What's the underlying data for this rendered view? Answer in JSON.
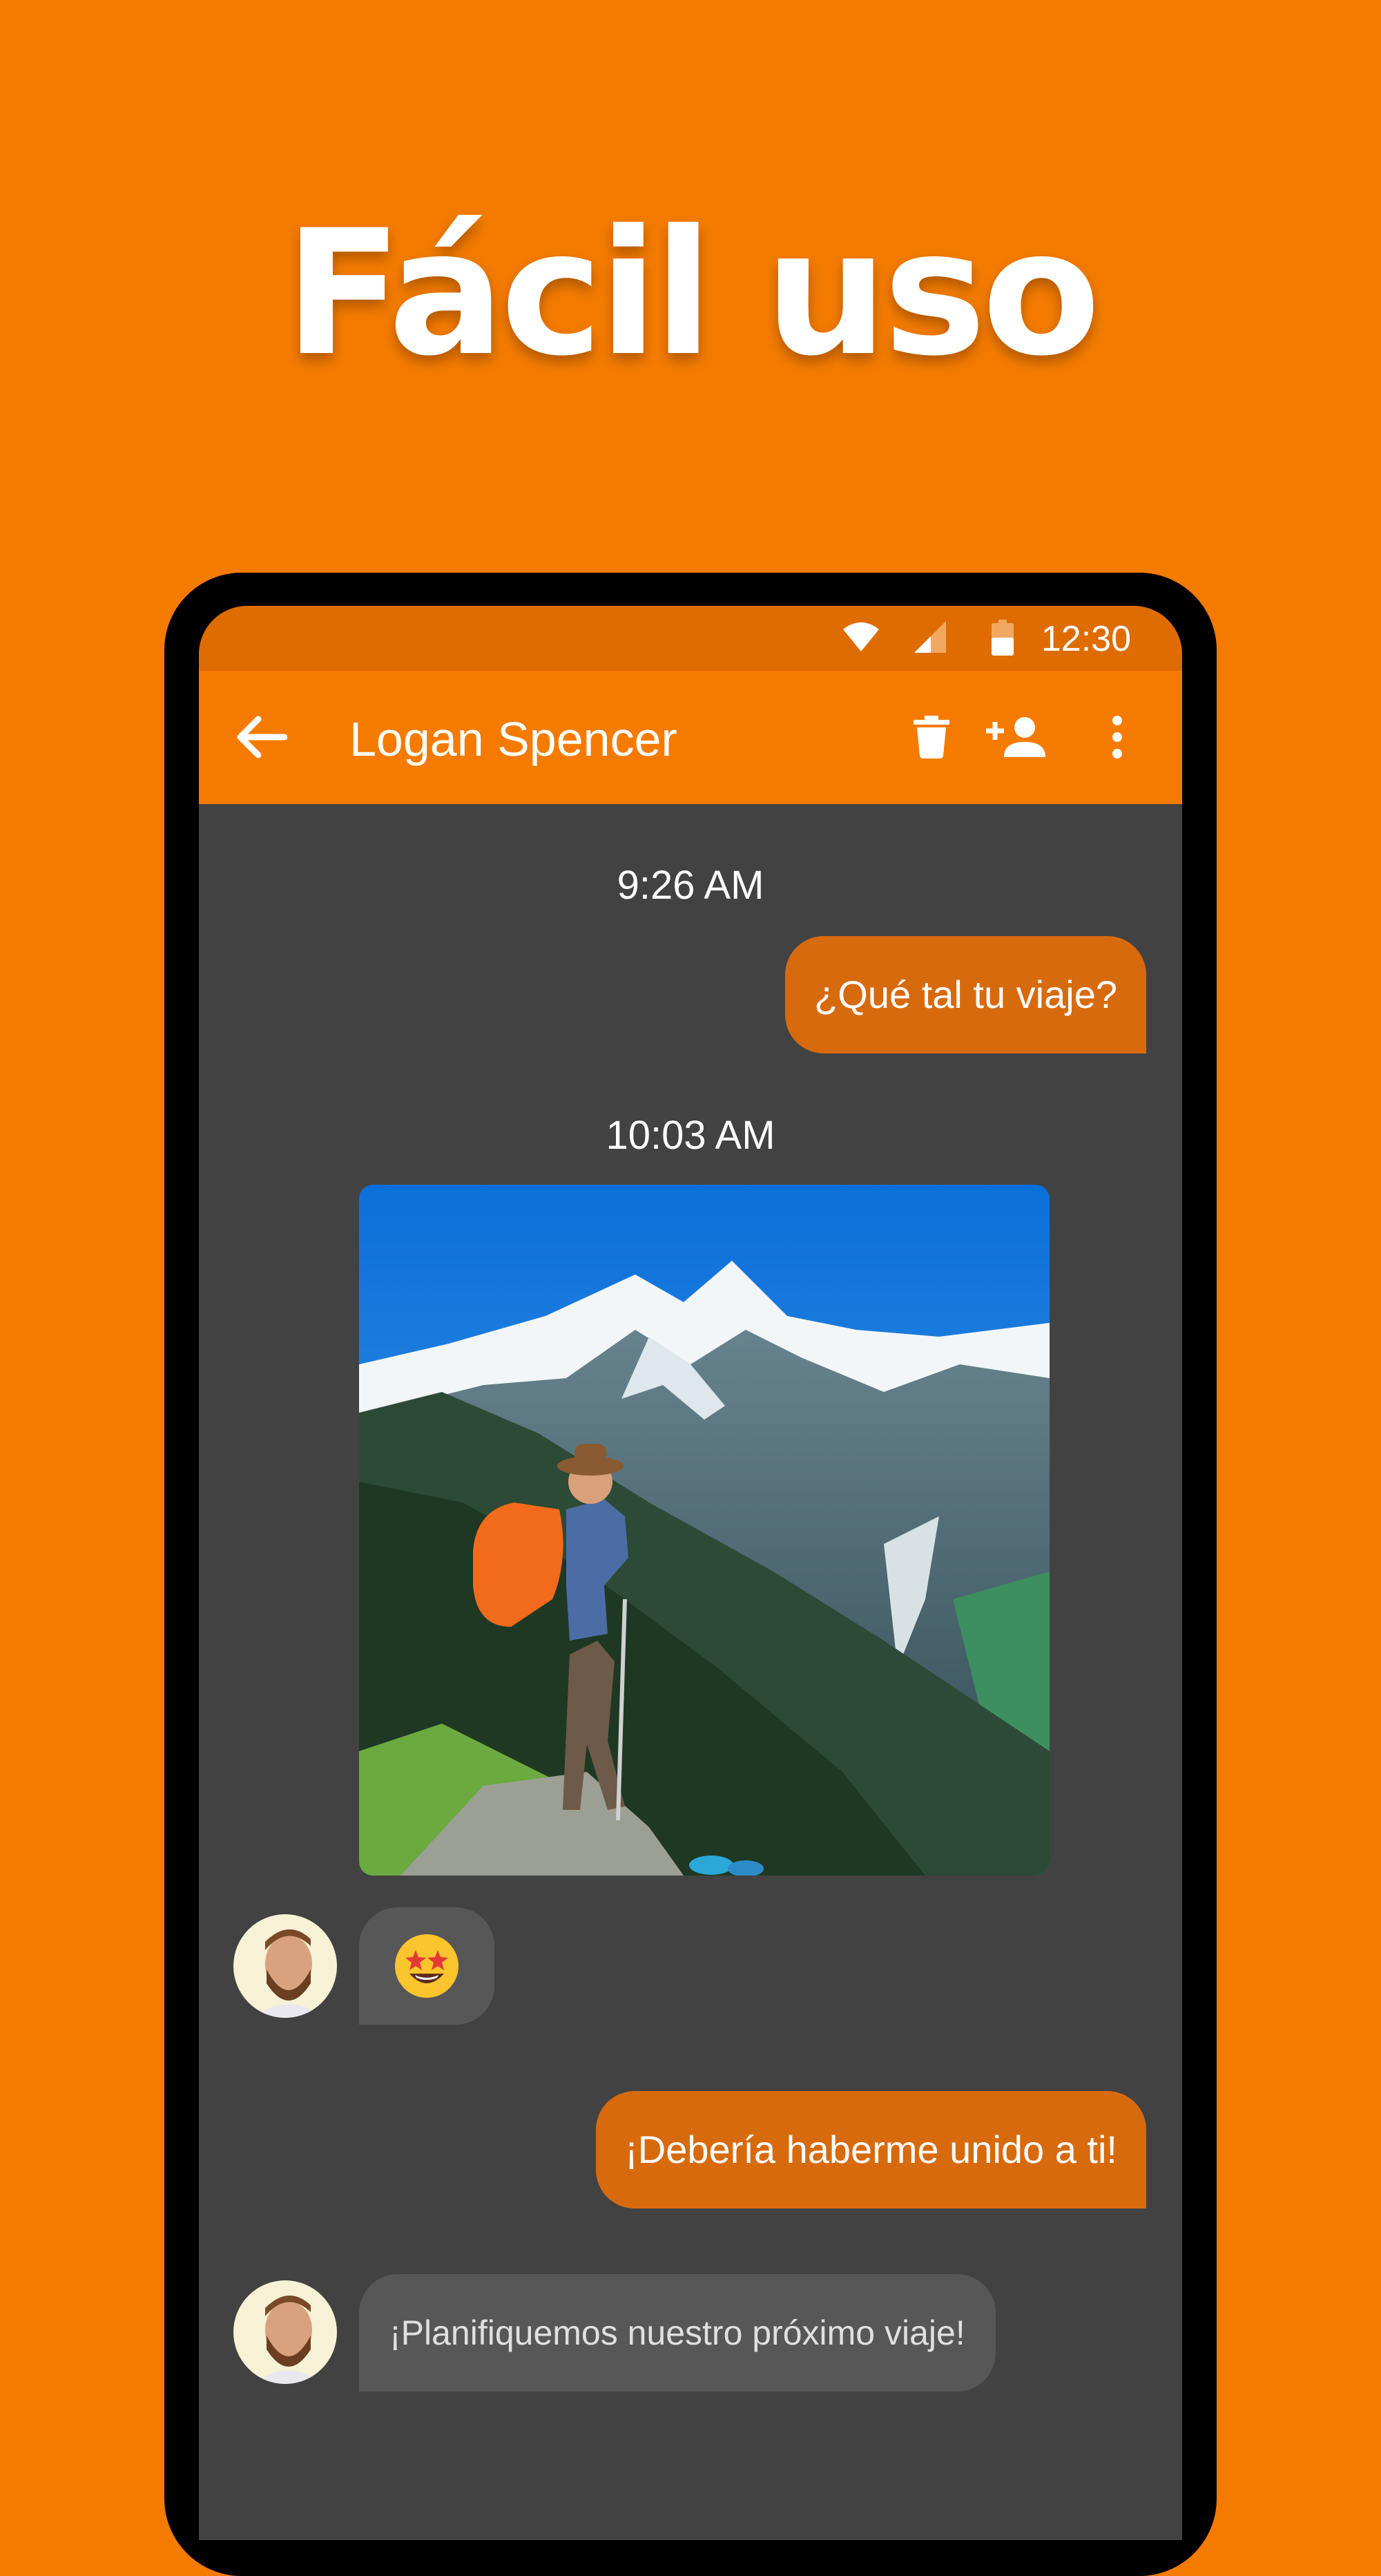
{
  "headline": "Fácil uso",
  "status_bar": {
    "time": "12:30",
    "icons": [
      "wifi-icon",
      "signal-icon",
      "battery-icon"
    ]
  },
  "app_bar": {
    "contact_name": "Logan Spencer",
    "icons": [
      "back-arrow-icon",
      "delete-icon",
      "add-person-icon",
      "more-options-icon"
    ]
  },
  "conversation": {
    "timestamps": [
      "9:26 AM",
      "10:03 AM"
    ],
    "messages": [
      {
        "direction": "outgoing",
        "text": "¿Qué tal tu viaje?"
      },
      {
        "direction": "incoming",
        "type": "image",
        "content": "hiker-mountain-photo"
      },
      {
        "direction": "incoming",
        "type": "emoji",
        "content": "star-struck-emoji"
      },
      {
        "direction": "outgoing",
        "text": "¡Debería haberme unido a ti!"
      },
      {
        "direction": "incoming",
        "text": "¡Planifiquemos nuestro próximo viaje!"
      }
    ]
  },
  "colors": {
    "background": "#F47B00",
    "status_bar": "#DE6C00",
    "app_bar": "#F47B00",
    "chat_background": "#424242",
    "outgoing_bubble": "#D86A0E",
    "incoming_bubble": "#575757"
  }
}
